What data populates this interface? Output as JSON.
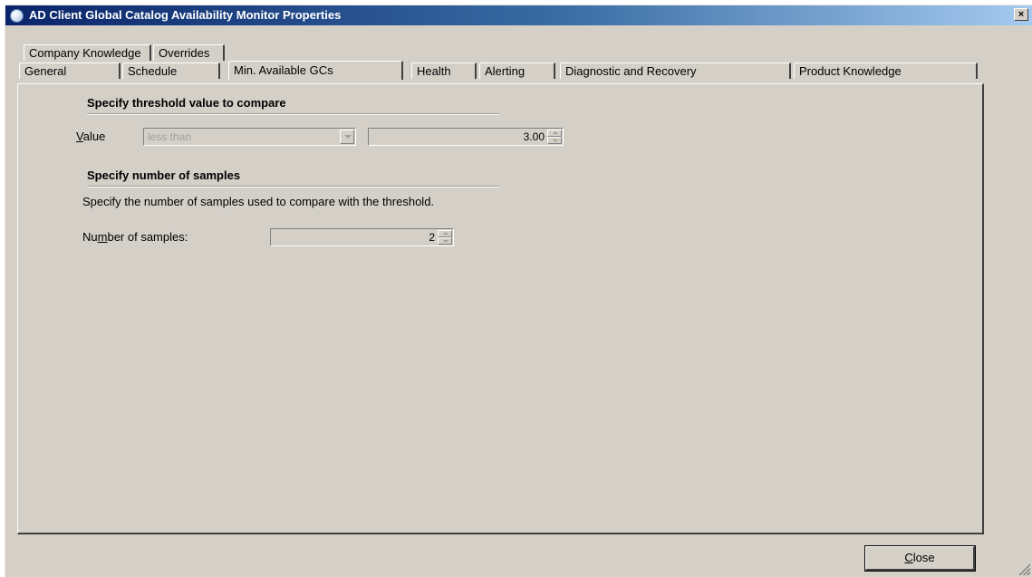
{
  "window": {
    "title": "AD Client Global Catalog Availability Monitor Properties",
    "close_glyph": "×"
  },
  "tabs_row1": [
    {
      "label": "Company Knowledge"
    },
    {
      "label": "Overrides"
    }
  ],
  "tabs_row2": [
    {
      "label": "General"
    },
    {
      "label": "Schedule"
    },
    {
      "label": "Min. Available GCs",
      "selected": true
    },
    {
      "label": "Health"
    },
    {
      "label": "Alerting"
    },
    {
      "label": "Diagnostic and Recovery"
    },
    {
      "label": "Product Knowledge"
    }
  ],
  "threshold": {
    "heading": "Specify threshold value to compare",
    "value_label_first": "V",
    "value_label_rest": "alue",
    "operator_selected": "less than",
    "value": "3.00"
  },
  "samples": {
    "heading": "Specify number of samples",
    "description": "Specify the number of samples used to compare with the threshold.",
    "label_pre": "Nu",
    "label_underline": "m",
    "label_post": "ber of samples:",
    "value": "2"
  },
  "footer": {
    "close_first": "C",
    "close_rest": "lose"
  },
  "icons": {
    "app": "monitor-properties-icon",
    "close": "close-icon",
    "dropdown": "chevron-down-icon",
    "spin_up": "spin-up-icon",
    "spin_down": "spin-down-icon",
    "grip": "resize-grip-icon"
  },
  "colors": {
    "titlebar_start": "#0a246a",
    "titlebar_end": "#a6caf0",
    "dialog_bg": "#d4d0c8",
    "disabled_text": "#a19f99"
  }
}
